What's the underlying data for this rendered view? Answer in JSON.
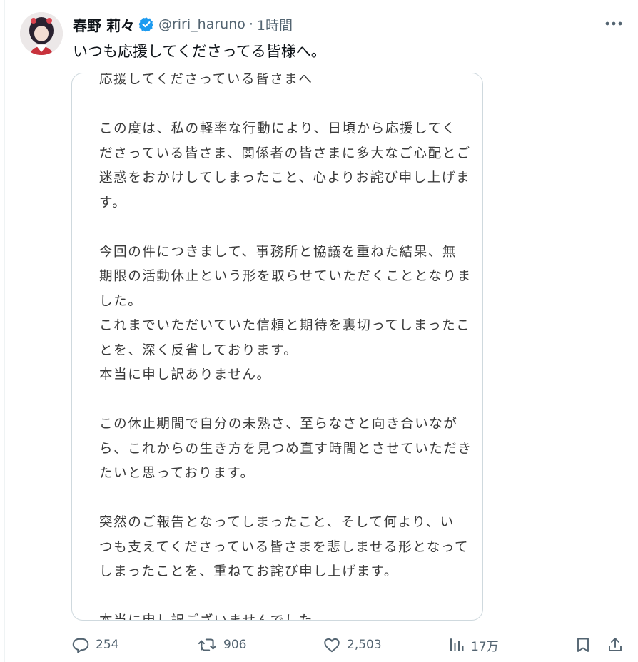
{
  "user": {
    "display_name": "春野 莉々",
    "handle": "@riri_haruno",
    "separator": "·",
    "time": "1時間",
    "avatar_icon": "profile-avatar",
    "verified_icon": "verified-badge-icon"
  },
  "tweet": {
    "text": "いつも応援してくださってる皆様へ。"
  },
  "media": {
    "statement_lines": [
      "応援してくださっている皆さまへ",
      "",
      "この度は、私の軽率な行動により、日頃から応援してく",
      "ださっている皆さま、関係者の皆さまに多大なご心配とご",
      "迷惑をおかけしてしまったこと、心よりお詫び申し上げま",
      "す。",
      "",
      "今回の件につきまして、事務所と協議を重ねた結果、無",
      "期限の活動休止という形を取らせていただくこととなりま",
      "した。",
      "これまでいただいていた信頼と期待を裏切ってしまったこ",
      "とを、深く反省しております。",
      "本当に申し訳ありません。",
      "",
      "この休止期間で自分の未熟さ、至らなさと向き合いなが",
      "ら、これからの生き方を見つめ直す時間とさせていただき",
      "たいと思っております。",
      "",
      "突然のご報告となってしまったこと、そして何より、い",
      "つも支えてくださっている皆さまを悲しませる形となって",
      "しまったことを、重ねてお詫び申し上げます。",
      "",
      "本当に申し訳ございませんでした。"
    ]
  },
  "actions": {
    "replies": "254",
    "reposts": "906",
    "likes": "2,503",
    "views": "17万"
  },
  "icons": {
    "more": "more-options-icon",
    "reply": "reply-icon",
    "repost": "repost-icon",
    "like": "like-icon",
    "views": "views-icon",
    "bookmark": "bookmark-icon",
    "share": "share-icon"
  },
  "colors": {
    "verified": "#1d9bf0",
    "secondary_text": "#536471",
    "primary_text": "#0f1419",
    "border": "#cfd9de"
  }
}
